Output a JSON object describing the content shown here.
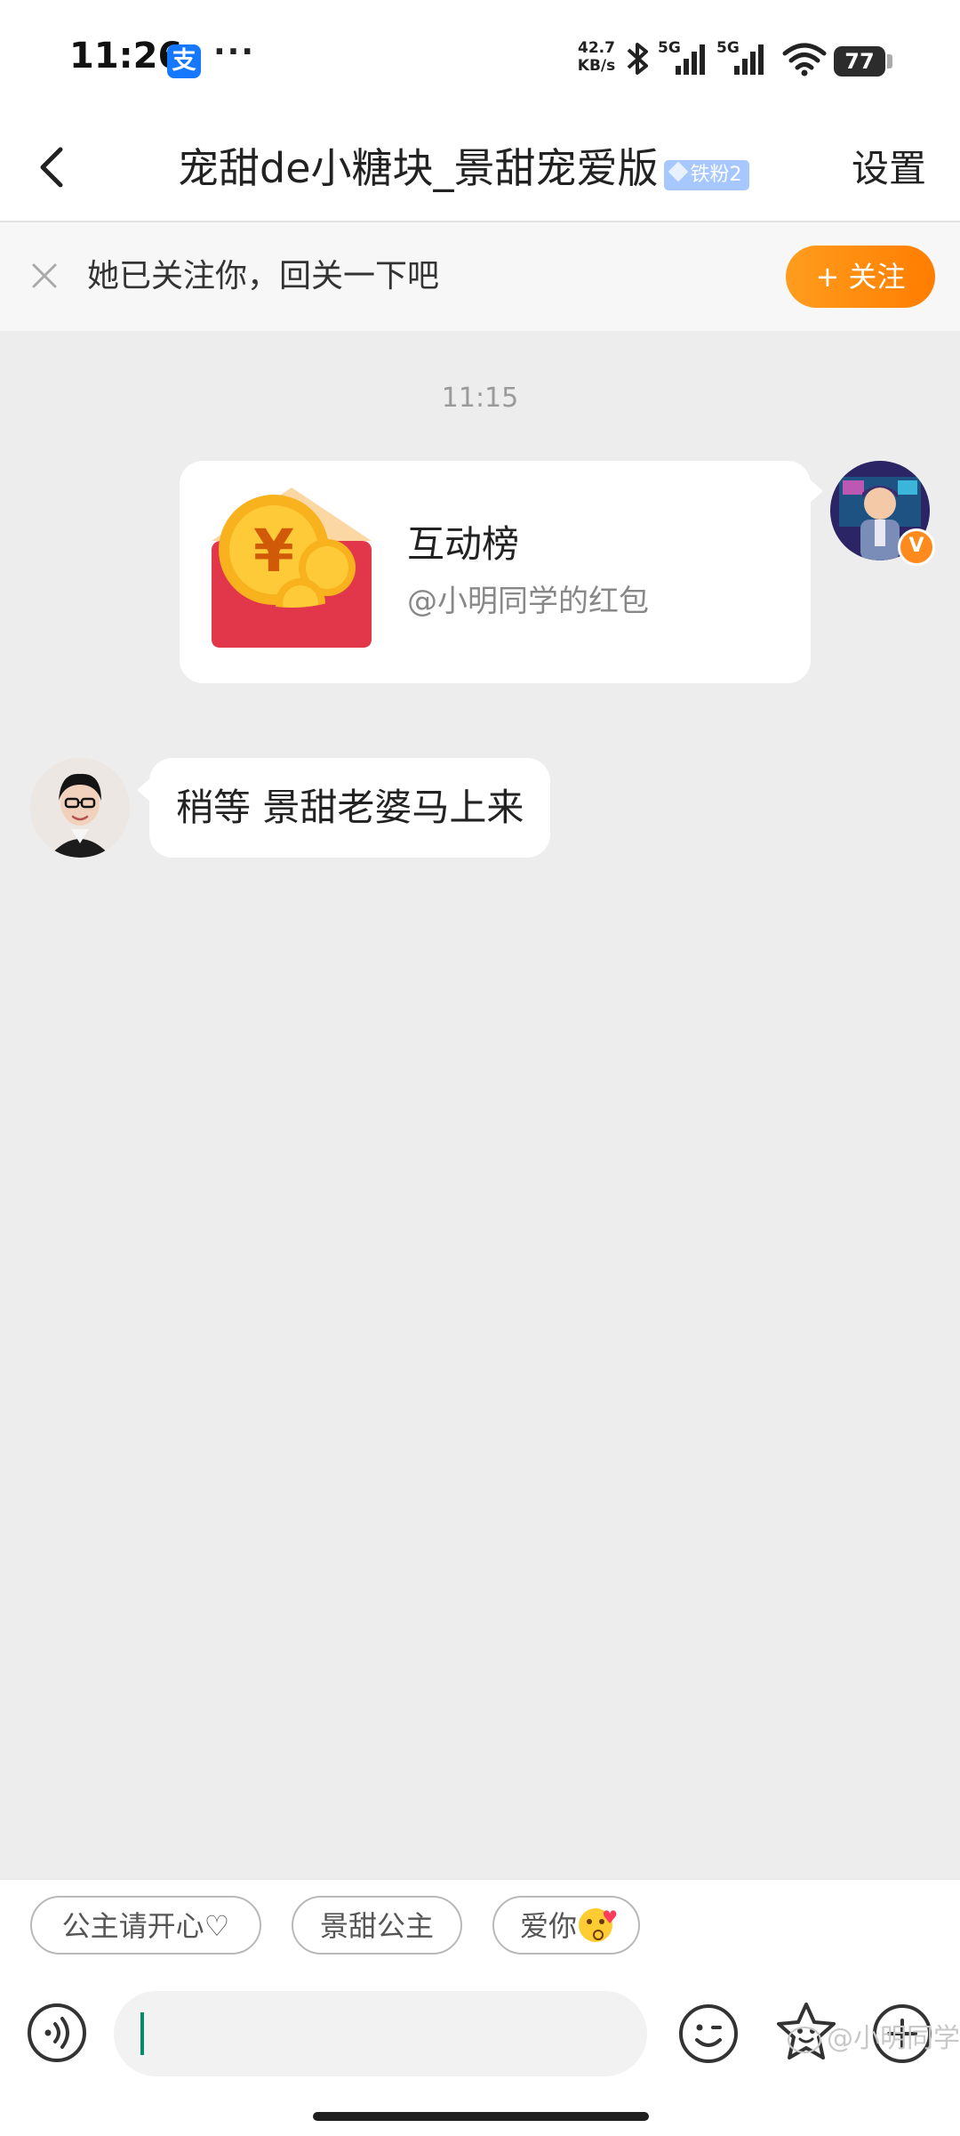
{
  "status_bar": {
    "time": "11:26",
    "app_badge": "支",
    "dots": "···",
    "net_speed_value": "42.7",
    "net_speed_unit": "KB/s",
    "signal1_label": "5G",
    "signal2_label": "5G",
    "battery": "77"
  },
  "header": {
    "title": "宠甜de小糖块_景甜宠爱版",
    "fan_badge": "铁粉2",
    "settings": "设置"
  },
  "follow_bar": {
    "text": "她已关注你，回关一下吧",
    "button": "+ 关注"
  },
  "chat": {
    "time": "11:15",
    "red_packet": {
      "title": "互动榜",
      "subtitle": "@小明同学的红包"
    },
    "message": "稍等 景甜老婆马上来",
    "verified_badge": "V"
  },
  "quick_replies": [
    "公主请开心♡",
    "景甜公主",
    "爱你"
  ],
  "watermark": "@小明同学",
  "colors": {
    "accent_orange": "#ff8a1e",
    "red_packet": "#e2364a",
    "background": "#ededed"
  }
}
